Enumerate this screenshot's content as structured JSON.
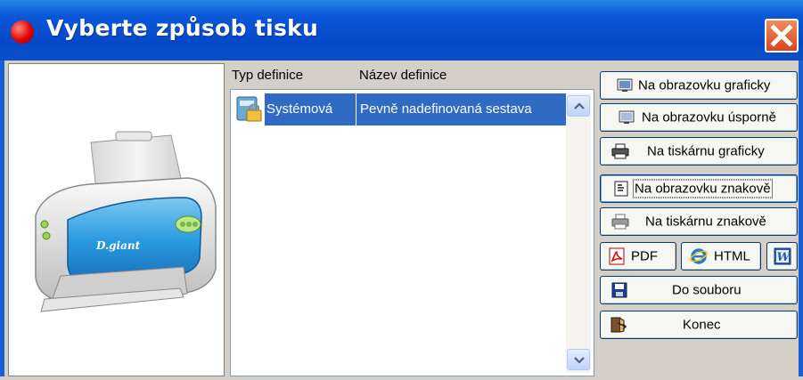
{
  "window": {
    "title": "Vyberte způsob tisku"
  },
  "list": {
    "headers": [
      "Typ definice",
      "Název definice"
    ],
    "rows": [
      {
        "type": "Systémová",
        "name": "Pevně nadefinovaná sestava",
        "selected": true
      }
    ]
  },
  "buttons": {
    "screen_graphic": "Na obrazovku graficky",
    "screen_economic": "Na obrazovku úsporně",
    "printer_graphic": "Na tiskárnu graficky",
    "screen_text": "Na obrazovku znakově",
    "printer_text": "Na tiskárnu znakově",
    "pdf": "PDF",
    "html": "HTML",
    "to_file": "Do souboru",
    "end": "Konec"
  },
  "preview": {
    "printer_brand": "D.giant"
  },
  "icons": {
    "title": "red-dot-icon",
    "close": "close-icon",
    "row": "lock-icon",
    "screen": "monitor-icon",
    "printer": "printer-icon",
    "text_screen": "text-document-icon",
    "pdf": "pdf-icon",
    "html": "internet-explorer-icon",
    "word": "word-icon",
    "file": "floppy-disk-icon",
    "exit": "exit-door-icon"
  },
  "colors": {
    "titlebar": "#0a4fc8",
    "selection": "#316ac5",
    "close": "#d8461c"
  }
}
